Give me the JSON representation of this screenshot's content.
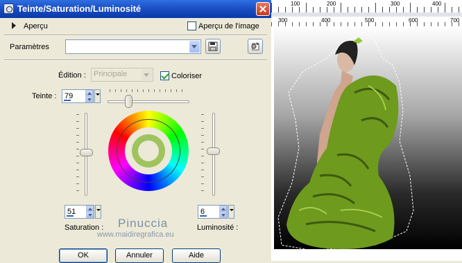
{
  "dialog": {
    "title": "Teinte/Saturation/Luminosité",
    "apercu_label": "Aperçu",
    "apercu_image_label": "Aperçu de l'image",
    "apercu_image_checked": false,
    "parametres_label": "Paramètres",
    "parametres_value": "",
    "edition_label": "Édition :",
    "edition_value": "Principale",
    "coloriser_label": "Coloriser",
    "coloriser_checked": true,
    "teinte_label": "Teinte :",
    "teinte_value": "79",
    "saturation_label": "Saturation :",
    "saturation_value": "51",
    "luminosite_label": "Luminosité :",
    "luminosite_value": "6",
    "buttons": {
      "ok": "OK",
      "cancel": "Annuler",
      "help": "Aide"
    }
  },
  "watermark": {
    "line1": "Pinuccia",
    "line2": "www.maidiregrafica.eu"
  },
  "canvas": {
    "ruler_top": [
      "100",
      "200",
      "300",
      "400"
    ],
    "ruler_bottom": [
      "300",
      "400",
      "500",
      "600",
      "700"
    ]
  },
  "colors": {
    "accent": "#2f6fe0",
    "colorize_ring": "#9fc35d",
    "dress": "#6e9a1e"
  },
  "icons": [
    "app-icon",
    "close-icon",
    "expand-arrow-icon",
    "save-preset-icon",
    "reset-preset-icon",
    "color-wheel"
  ]
}
